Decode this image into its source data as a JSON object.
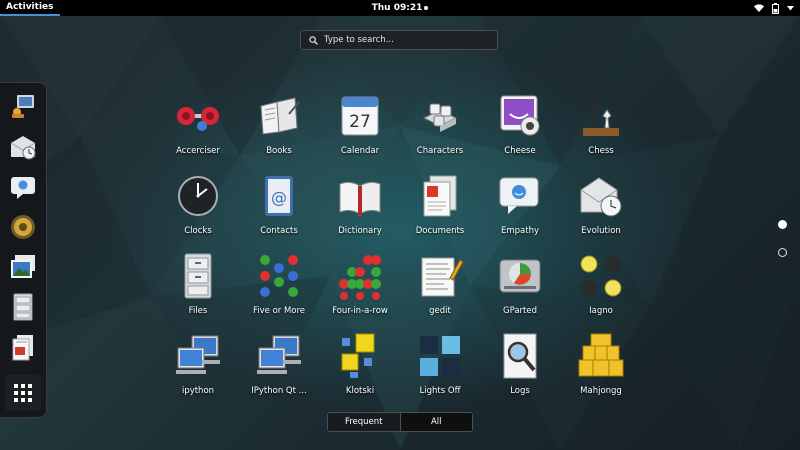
{
  "topbar": {
    "activities": "Activities",
    "clock": "Thu 09:21"
  },
  "search": {
    "placeholder": "Type to search..."
  },
  "dash": {
    "items": [
      {
        "icon": "display-settings-icon"
      },
      {
        "icon": "mail-clock-icon"
      },
      {
        "icon": "chat-bubble-icon"
      },
      {
        "icon": "speaker-icon"
      },
      {
        "icon": "photos-icon"
      },
      {
        "icon": "file-cabinet-icon"
      },
      {
        "icon": "documents-icon"
      }
    ],
    "show_apps": "show-applications-icon"
  },
  "apps": [
    {
      "label": "Accerciser",
      "icon": "dumbbell-icon"
    },
    {
      "label": "Books",
      "icon": "book-icon"
    },
    {
      "label": "Calendar",
      "icon": "calendar-icon",
      "day": "27"
    },
    {
      "label": "Characters",
      "icon": "keyboard-keys-icon"
    },
    {
      "label": "Cheese",
      "icon": "webcam-icon"
    },
    {
      "label": "Chess",
      "icon": "chess-pieces-icon"
    },
    {
      "label": "Clocks",
      "icon": "clock-icon"
    },
    {
      "label": "Contacts",
      "icon": "address-book-icon"
    },
    {
      "label": "Dictionary",
      "icon": "open-book-icon"
    },
    {
      "label": "Documents",
      "icon": "document-stack-icon"
    },
    {
      "label": "Empathy",
      "icon": "chat-icon"
    },
    {
      "label": "Evolution",
      "icon": "envelope-clock-icon"
    },
    {
      "label": "Files",
      "icon": "filing-cabinet-icon"
    },
    {
      "label": "Five or More",
      "icon": "colored-balls-icon"
    },
    {
      "label": "Four-in-a-row",
      "icon": "four-in-row-icon"
    },
    {
      "label": "gedit",
      "icon": "text-editor-icon"
    },
    {
      "label": "GParted",
      "icon": "disk-partition-icon"
    },
    {
      "label": "Iagno",
      "icon": "reversi-discs-icon"
    },
    {
      "label": "ipython",
      "icon": "computers-icon"
    },
    {
      "label": "IPython Qt ...",
      "icon": "computers-icon"
    },
    {
      "label": "Klotski",
      "icon": "sliding-blocks-icon"
    },
    {
      "label": "Lights Off",
      "icon": "light-tiles-icon"
    },
    {
      "label": "Logs",
      "icon": "magnifier-log-icon"
    },
    {
      "label": "Mahjongg",
      "icon": "mahjong-tiles-icon"
    }
  ],
  "pages": {
    "current": 1,
    "total": 2
  },
  "view": {
    "frequent": "Frequent",
    "all": "All",
    "selected": "All"
  },
  "colors": {
    "accent": "#4a90d9",
    "topbar": "#000000"
  }
}
